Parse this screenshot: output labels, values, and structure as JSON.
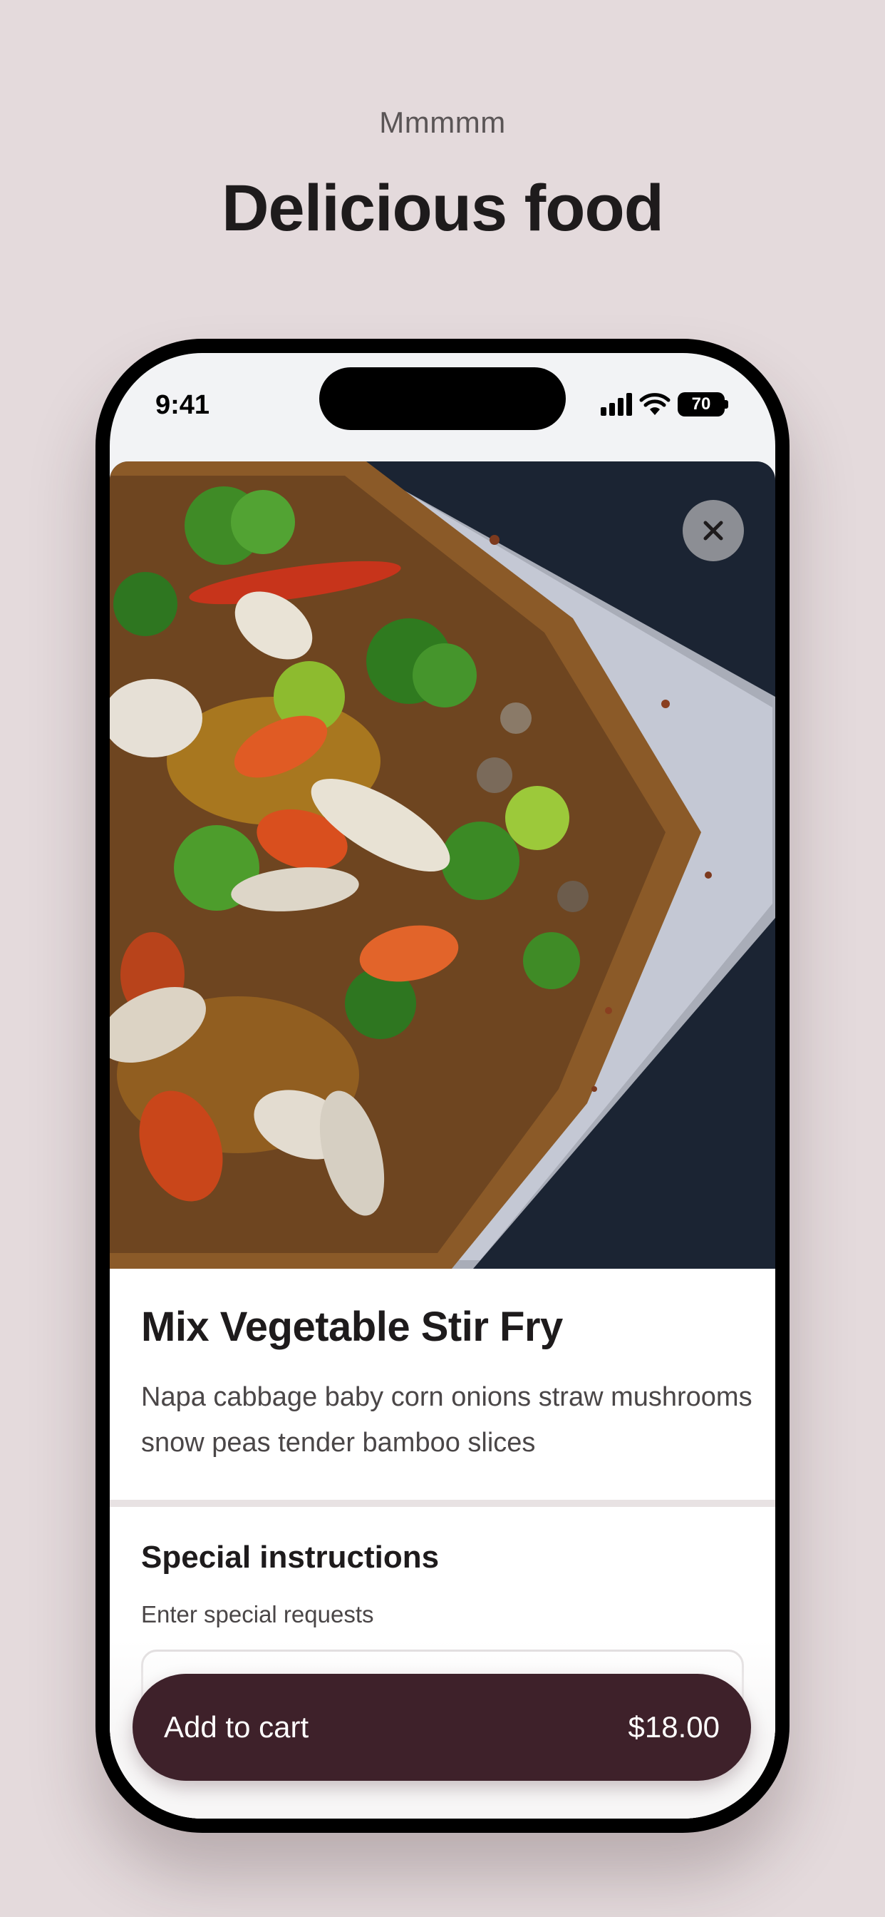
{
  "header": {
    "eyebrow": "Mmmmm",
    "headline": "Delicious food"
  },
  "status_bar": {
    "time": "9:41",
    "battery_level": "70",
    "icons": [
      "cellular-signal-icon",
      "wifi-icon",
      "battery-icon"
    ]
  },
  "item": {
    "photo_icon": "food-photo",
    "title": "Mix Vegetable Stir Fry",
    "description": "Napa cabbage baby corn onions straw mushrooms snow peas tender bamboo slices",
    "close_icon": "close-icon"
  },
  "special_instructions": {
    "title": "Special instructions",
    "subtitle": "Enter special requests",
    "value": "",
    "placeholder": ""
  },
  "cart": {
    "label": "Add to cart",
    "price": "$18.00"
  },
  "colors": {
    "background": "#e4dadc",
    "accent": "#3e212a",
    "text_primary": "#1e1b1c"
  }
}
